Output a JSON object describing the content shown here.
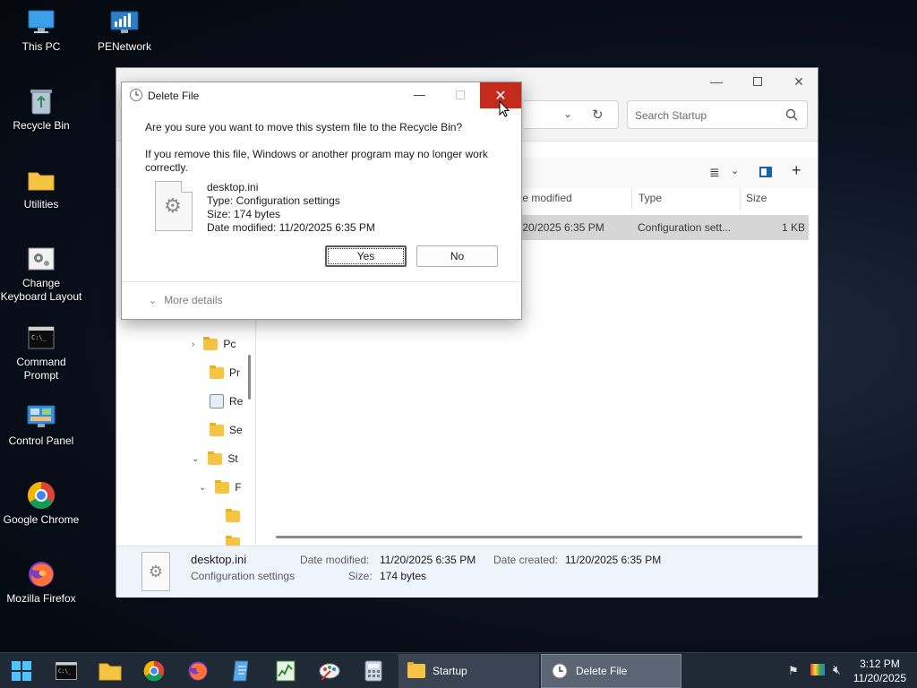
{
  "desktop": {
    "icons": [
      {
        "label": "This PC"
      },
      {
        "label": "PENetwork"
      },
      {
        "label": "Recycle Bin"
      },
      {
        "label": "Utilities"
      },
      {
        "label": "Change Keyboard Layout"
      },
      {
        "label": "Command Prompt"
      },
      {
        "label": "Control Panel"
      },
      {
        "label": "Google Chrome"
      },
      {
        "label": "Mozilla Firefox"
      }
    ]
  },
  "explorer": {
    "search_placeholder": "Search Startup",
    "columns": {
      "date_modified": "te modified",
      "type": "Type",
      "size": "Size"
    },
    "file_row": {
      "date": "/20/2025 6:35 PM",
      "type": "Configuration sett...",
      "size": "1 KB"
    },
    "nav_items": [
      "Pc",
      "Pr",
      "Re",
      "Se",
      "St",
      "F"
    ],
    "details": {
      "name": "desktop.ini",
      "type": "Configuration settings",
      "date_modified_label": "Date modified:",
      "date_modified": "11/20/2025 6:35 PM",
      "date_created_label": "Date created:",
      "date_created": "11/20/2025 6:35 PM",
      "size_label": "Size:",
      "size": "174 bytes"
    }
  },
  "dialog": {
    "title": "Delete File",
    "question": "Are you sure you want to move this system file to the Recycle Bin?",
    "warning_line1": "If you remove this file, Windows or another program may no longer work",
    "warning_line2": "correctly.",
    "file": {
      "name": "desktop.ini",
      "type": "Type: Configuration settings",
      "size": "Size: 174 bytes",
      "date_modified": "Date modified: 11/20/2025 6:35 PM"
    },
    "yes_label": "Yes",
    "no_label": "No",
    "more_details": "More details"
  },
  "taskbar": {
    "tasks": [
      {
        "label": "Startup"
      },
      {
        "label": "Delete File"
      }
    ],
    "time": "3:12 PM",
    "date": "11/20/2025"
  },
  "colors": {
    "close_red": "#c42b1c",
    "taskbar_bg": "#202a36",
    "folder_yellow": "#f6c443"
  }
}
